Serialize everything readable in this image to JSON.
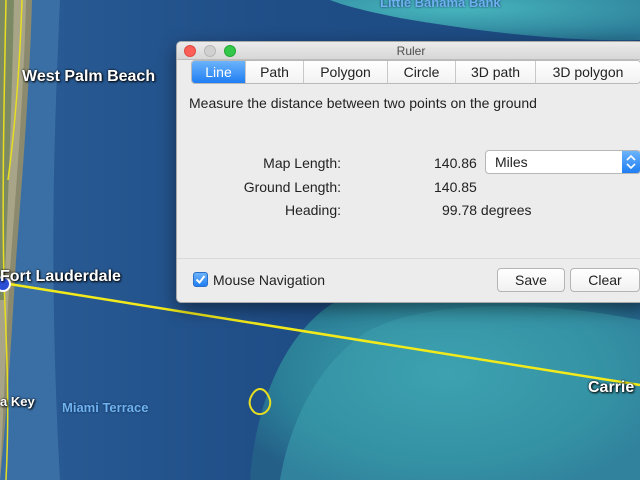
{
  "map": {
    "labels": {
      "top": "Little Bahama Bank",
      "west_palm_beach": "West Palm Beach",
      "fort_lauderdale": "Fort Lauderdale",
      "key": "a Key",
      "miami_terrace": "Miami Terrace",
      "carries": "Carrie"
    },
    "ruler_line_color": "#f2ea1a"
  },
  "window": {
    "title": "Ruler",
    "tabs": [
      {
        "label": "Line",
        "active": true
      },
      {
        "label": "Path"
      },
      {
        "label": "Polygon"
      },
      {
        "label": "Circle"
      },
      {
        "label": "3D path"
      },
      {
        "label": "3D polygon"
      }
    ],
    "description": "Measure the distance between two points on the ground",
    "map_length": {
      "label": "Map Length:",
      "value": "140.86"
    },
    "ground_length": {
      "label": "Ground Length:",
      "value": "140.85"
    },
    "heading": {
      "label": "Heading:",
      "value": "99.78 degrees"
    },
    "units": {
      "selected": "Miles"
    },
    "mouse_navigation": {
      "label": "Mouse Navigation",
      "checked": true
    },
    "save_label": "Save",
    "clear_label": "Clear"
  },
  "colors": {
    "accent": "#1f7ef3",
    "close": "#fc5f57",
    "zoom": "#34c84a"
  }
}
